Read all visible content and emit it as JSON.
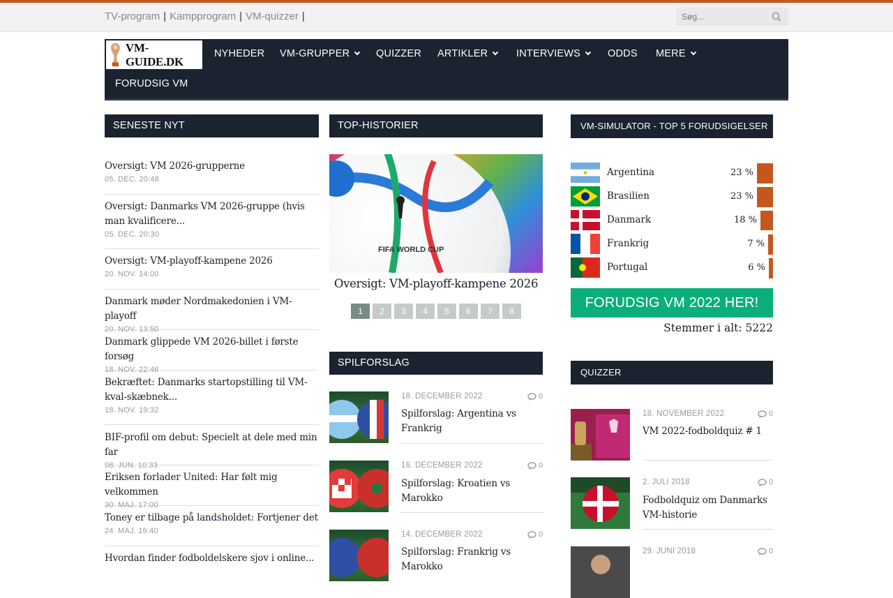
{
  "topbar": {
    "links": [
      "TV-program",
      "Kampprogram",
      "VM-quizzer"
    ],
    "separator": "|",
    "search_placeholder": "Søg..."
  },
  "logo": {
    "text": "VM-GUIDE.DK"
  },
  "nav": {
    "items": [
      {
        "label": "NYHEDER"
      },
      {
        "label": "VM-GRUPPER"
      },
      {
        "label": "QUIZZER"
      },
      {
        "label": "ARTIKLER"
      },
      {
        "label": "INTERVIEWS"
      },
      {
        "label": "ODDS"
      },
      {
        "label": "MERE"
      },
      {
        "label": "FORUDSIG VM"
      }
    ]
  },
  "latest": {
    "heading": "SENESTE NYT",
    "items": [
      {
        "title": "Oversigt: VM 2026-grupperne",
        "date": "05. DEC. 20:48"
      },
      {
        "title": "Oversigt: Danmarks VM 2026-gruppe (hvis man kvalificere...",
        "date": "05. DEC. 20:30"
      },
      {
        "title": "Oversigt: VM-playoff-kampene 2026",
        "date": "20. NOV. 14:00"
      },
      {
        "title": "Danmark møder Nordmakedonien i VM-playoff",
        "date": "20. NOV. 13:50"
      },
      {
        "title": "Danmark glippede VM 2026-billet i første forsøg",
        "date": "18. NOV. 22:46"
      },
      {
        "title": "Bekræftet: Danmarks startopstilling til VM-kval-skæbnek...",
        "date": "18. NOV. 19:32"
      },
      {
        "title": "BIF-profil om debut: Specielt at dele med min far",
        "date": "08. JUN. 10:33"
      },
      {
        "title": "Eriksen forlader United: Har følt mig velkommen",
        "date": "30. MAJ. 17:00"
      },
      {
        "title": "Toney er tilbage på landsholdet: Fortjener det",
        "date": "24. MAJ. 16:40"
      },
      {
        "title": "Hvordan finder fodboldelskere sjov i online...",
        "date": ""
      }
    ]
  },
  "top": {
    "heading": "TOP-HISTORIER",
    "caption": "Oversigt: VM-playoff-kampene 2026",
    "ball_text": "FIFA WORLD CUP",
    "pages": [
      "1",
      "2",
      "3",
      "4",
      "5",
      "6",
      "7",
      "8"
    ],
    "active_page": "1"
  },
  "tips": {
    "heading": "SPILFORSLAG",
    "items": [
      {
        "date": "18. DECEMBER 2022",
        "comments": "0",
        "title": "Spilforslag: Argentina vs Frankrig"
      },
      {
        "date": "16. DECEMBER 2022",
        "comments": "0",
        "title": "Spilforslag: Kroatien vs Marokko"
      },
      {
        "date": "14. DECEMBER 2022",
        "comments": "0",
        "title": "Spilforslag: Frankrig vs Marokko"
      }
    ]
  },
  "simulator": {
    "heading": "VM-SIMULATOR - TOP 5 FORUDSIGELSER",
    "rows": [
      {
        "country": "Argentina",
        "pct": "23 %",
        "value": 23
      },
      {
        "country": "Brasilien",
        "pct": "23 %",
        "value": 23
      },
      {
        "country": "Danmark",
        "pct": "18 %",
        "value": 18
      },
      {
        "country": "Frankrig",
        "pct": "7 %",
        "value": 7
      },
      {
        "country": "Portugal",
        "pct": "6 %",
        "value": 6
      }
    ],
    "cta": "FORUDSIG VM 2022 HER!",
    "votes": "Stemmer i alt: 5222"
  },
  "quiz": {
    "heading": "QUIZZER",
    "items": [
      {
        "date": "18. NOVEMBER 2022",
        "comments": "0",
        "title": "VM 2022-fodboldquiz # 1"
      },
      {
        "date": "2. JULI 2018",
        "comments": "0",
        "title": "Fodboldquiz om Danmarks VM-historie"
      },
      {
        "date": "29. JUNI 2018",
        "comments": "0",
        "title": ""
      }
    ]
  },
  "colors": {
    "accent": "#c4571e",
    "nav": "#1a232f",
    "cta": "#0aaf7a"
  }
}
